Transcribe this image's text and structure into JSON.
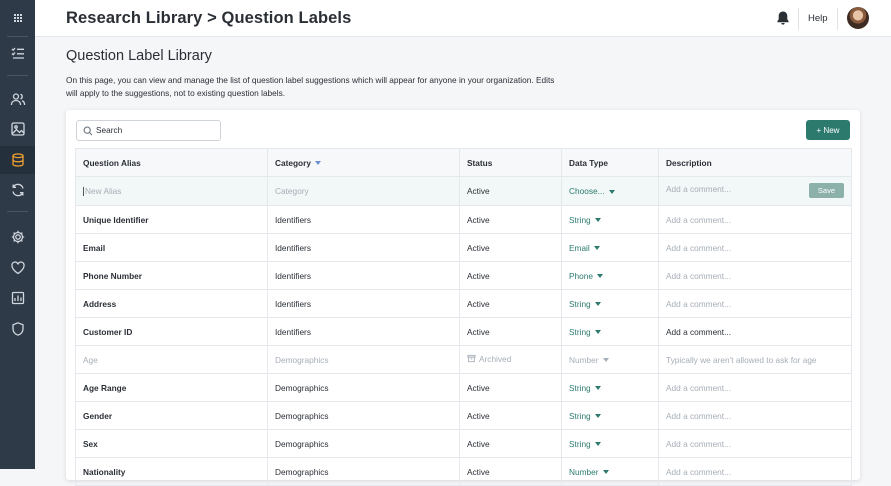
{
  "header": {
    "title": "Research Library > Question Labels",
    "help": "Help"
  },
  "page": {
    "heading": "Question Label Library",
    "description": "On this page, you can view and manage the list of question label suggestions which will appear for anyone in your organization. Edits will apply to the suggestions, not to existing question labels."
  },
  "toolbar": {
    "search_placeholder": "Search",
    "new_label": "+ New"
  },
  "table": {
    "headers": [
      "Question Alias",
      "Category",
      "Status",
      "Data Type",
      "Description"
    ],
    "new_row": {
      "alias_placeholder": "New Alias",
      "category_placeholder": "Category",
      "status": "Active",
      "data_type": "Choose...",
      "comment_placeholder": "Add a comment...",
      "save": "Save"
    },
    "rows": [
      {
        "alias": "Unique Identifier",
        "category": "Identifiers",
        "status": "Active",
        "data_type": "String",
        "description": "Add a comment..."
      },
      {
        "alias": "Email",
        "category": "Identifiers",
        "status": "Active",
        "data_type": "Email",
        "description": "Add a comment..."
      },
      {
        "alias": "Phone Number",
        "category": "Identifiers",
        "status": "Active",
        "data_type": "Phone",
        "description": "Add a comment..."
      },
      {
        "alias": "Address",
        "category": "Identifiers",
        "status": "Active",
        "data_type": "String",
        "description": "Add a comment..."
      },
      {
        "alias": "Customer ID",
        "category": "Identifiers",
        "status": "Active",
        "data_type": "String",
        "description": "Add a comment..."
      },
      {
        "alias": "Age",
        "category": "Demographics",
        "status": "Archived",
        "data_type": "Number",
        "description": "Typically we aren't allowed to ask for age"
      },
      {
        "alias": "Age Range",
        "category": "Demographics",
        "status": "Active",
        "data_type": "String",
        "description": "Add a comment..."
      },
      {
        "alias": "Gender",
        "category": "Demographics",
        "status": "Active",
        "data_type": "String",
        "description": "Add a comment..."
      },
      {
        "alias": "Sex",
        "category": "Demographics",
        "status": "Active",
        "data_type": "String",
        "description": "Add a comment..."
      },
      {
        "alias": "Nationality",
        "category": "Demographics",
        "status": "Active",
        "data_type": "Number",
        "description": "Add a comment..."
      }
    ]
  },
  "sidebar": {
    "icons": [
      "apps-grid-icon",
      "checklist-icon",
      "users-icon",
      "image-icon",
      "database-icon",
      "sync-icon",
      "gear-icon",
      "heart-icon",
      "chart-icon",
      "shield-icon"
    ]
  },
  "colors": {
    "accent": "#2c7a6e",
    "sidebar": "#2f3a48"
  }
}
